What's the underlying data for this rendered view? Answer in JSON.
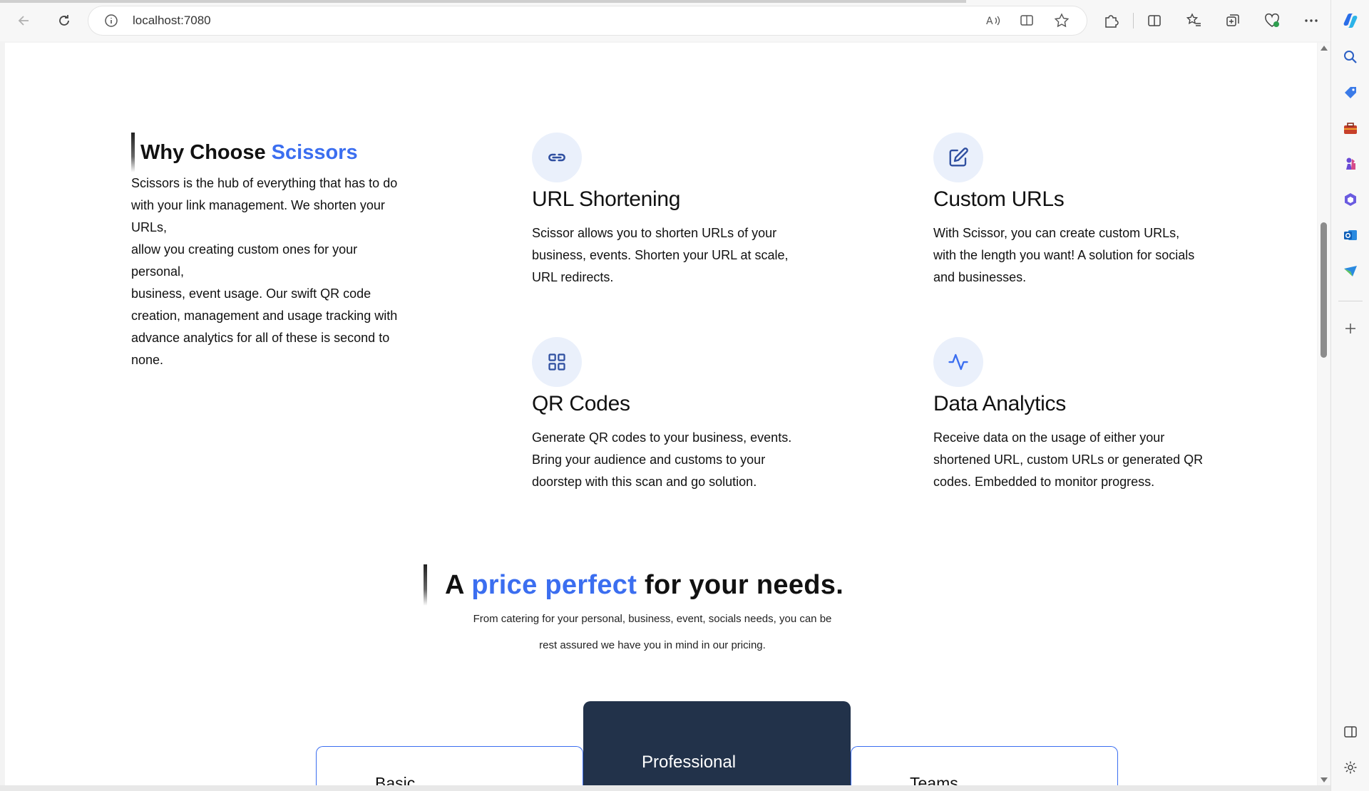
{
  "browser": {
    "url": "localhost:7080"
  },
  "why": {
    "heading_prefix": "Why Choose ",
    "heading_brand": "Scissors",
    "paragraph_lines": [
      "Scissors is the hub of everything that has to do",
      "with your link management. We shorten your",
      "URLs,",
      "allow you creating custom ones for your",
      "personal,",
      "business, event usage. Our swift QR code",
      "creation, management and usage tracking with",
      "advance analytics for all of these is second to",
      "none."
    ]
  },
  "features": [
    {
      "icon": "link-icon",
      "title": "URL Shortening",
      "lines": [
        "Scissor allows you to shorten URLs of your",
        "business, events. Shorten your URL at scale,",
        "URL redirects."
      ]
    },
    {
      "icon": "edit-icon",
      "title": "Custom URLs",
      "lines": [
        "With Scissor, you can create custom URLs,",
        "with the length you want! A solution for socials",
        "and businesses."
      ]
    },
    {
      "icon": "grid-icon",
      "title": "QR Codes",
      "lines": [
        "Generate QR codes to your business, events.",
        "Bring your audience and customs to your",
        "doorstep with this scan and go solution."
      ]
    },
    {
      "icon": "activity-icon",
      "title": "Data Analytics",
      "lines": [
        "Receive data on the usage of either your",
        "shortened URL, custom URLs or generated QR",
        "codes. Embedded to monitor progress."
      ]
    }
  ],
  "pricing": {
    "heading_a": "A ",
    "heading_highlight": "price perfect",
    "heading_rest": " for your needs.",
    "sub_line1": "From catering for your personal, business, event, socials needs, you can be",
    "sub_line2": "rest assured we have you in mind in our pricing.",
    "plans": [
      "Basic",
      "Professional",
      "Teams"
    ]
  },
  "colors": {
    "accent": "#3b6ef0",
    "pro_card": "#22324a",
    "icon_bg": "#eaf0fb"
  }
}
